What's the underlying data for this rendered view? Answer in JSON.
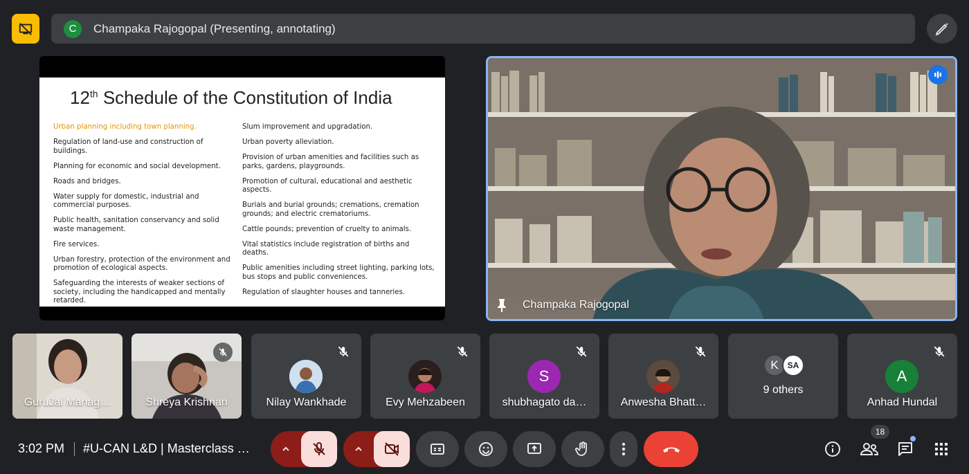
{
  "top": {
    "presenter_initial": "C",
    "presenting_label": "Champaka Rajogopal (Presenting, annotating)"
  },
  "slide": {
    "title_prefix": "12",
    "title_sup": "th",
    "title_rest": " Schedule of the Constitution of India",
    "left_items": [
      "Urban planning including town planning.",
      "Regulation of land-use and construction of buildings.",
      "Planning for economic and social development.",
      "Roads and bridges.",
      "Water supply for domestic, industrial and commercial purposes.",
      "Public health, sanitation conservancy and solid waste management.",
      "Fire services.",
      "Urban forestry, protection of the environment and promotion of ecological aspects.",
      "Safeguarding the interests of weaker sections of society, including the handicapped and mentally retarded."
    ],
    "right_items": [
      "Slum improvement and upgradation.",
      "Urban poverty alleviation.",
      "Provision of urban amenities and facilities such as parks, gardens, playgrounds.",
      "Promotion of cultural, educational and aesthetic aspects.",
      "Burials and burial grounds; cremations, cremation grounds; and electric crematoriums.",
      "Cattle pounds; prevention of cruelty to animals.",
      "Vital statistics include registration of births and deaths.",
      "Public amenities including street lighting, parking lots, bus stops and public conveniences.",
      "Regulation of slaughter houses and tanneries."
    ]
  },
  "speaker": {
    "name": "Champaka Rajogopal"
  },
  "participants": [
    {
      "name": "GuruJal Manag…",
      "type": "video"
    },
    {
      "name": "Shreya Krishnan",
      "type": "video"
    },
    {
      "name": "Nilay Wankhade",
      "type": "photo"
    },
    {
      "name": "Evy Mehzabeen",
      "type": "photo"
    },
    {
      "name": "shubhagato da…",
      "type": "initial",
      "initial": "S",
      "color": "#9c27b0"
    },
    {
      "name": "Anwesha Bhatt…",
      "type": "photo"
    },
    {
      "name": "9 others",
      "type": "group",
      "initials": [
        "K",
        "SA"
      ]
    },
    {
      "name": "Anhad Hundal",
      "type": "initial",
      "initial": "A",
      "color": "#188038"
    }
  ],
  "bottom": {
    "time": "3:02 PM",
    "meeting_title": "#U-CAN L&D | Masterclass b…",
    "participant_count": "18"
  },
  "colors": {
    "accent_blue": "#8ab4f8",
    "hangup_red": "#ea4335",
    "present_yellow": "#fbbc04",
    "highlight_orange": "#e69500"
  }
}
